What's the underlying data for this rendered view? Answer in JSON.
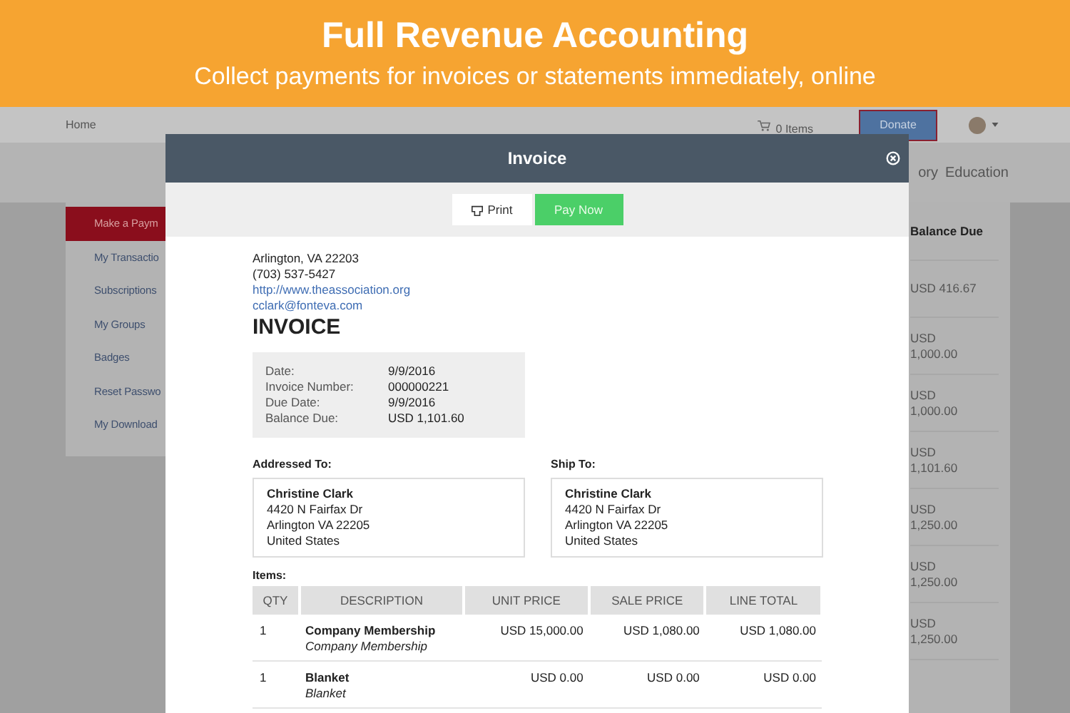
{
  "banner": {
    "title": "Full Revenue Accounting",
    "subtitle": "Collect payments for invoices or statements immediately, online"
  },
  "topbar": {
    "home": "Home",
    "cart": "0 Items",
    "donate": "Donate"
  },
  "nav": [
    "ory",
    "Education"
  ],
  "sidebar": [
    {
      "label": "Make a Paym",
      "selected": true
    },
    {
      "label": "My Transactio",
      "selected": false
    },
    {
      "label": "Subscriptions",
      "selected": false
    },
    {
      "label": "My Groups",
      "selected": false
    },
    {
      "label": "Badges",
      "selected": false
    },
    {
      "label": "Reset Passwo",
      "selected": false
    },
    {
      "label": "My Download",
      "selected": false
    }
  ],
  "balance": {
    "heading": "Balance Due",
    "rows": [
      "USD 416.67",
      "USD 1,000.00",
      "USD 1,000.00",
      "USD 1,101.60",
      "USD 1,250.00",
      "USD 1,250.00",
      "USD 1,250.00"
    ]
  },
  "modal": {
    "title": "Invoice",
    "print": "Print",
    "pay": "Pay Now",
    "address": [
      {
        "kind": "text",
        "text": "Arlington, VA 22203"
      },
      {
        "kind": "text",
        "text": "(703) 537-5427"
      },
      {
        "kind": "link",
        "text": "http://www.theassociation.org"
      },
      {
        "kind": "link",
        "text": "cclark@fonteva.com"
      }
    ],
    "heading": "INVOICE",
    "info": [
      {
        "label": "Date:",
        "value": "9/9/2016"
      },
      {
        "label": "Invoice Number:",
        "value": "000000221"
      },
      {
        "label": "Due Date:",
        "value": "9/9/2016"
      },
      {
        "label": "Balance Due:",
        "value": "USD 1,101.60"
      }
    ],
    "parties": [
      {
        "heading": "Addressed To:",
        "name": "Christine Clark",
        "lines": [
          "4420 N Fairfax Dr",
          "Arlington VA 22205",
          "United States"
        ]
      },
      {
        "heading": "Ship To:",
        "name": "Christine Clark",
        "lines": [
          "4420 N Fairfax Dr",
          "Arlington VA 22205",
          "United States"
        ]
      }
    ],
    "items_label": "Items:",
    "table": {
      "columns": [
        "QTY",
        "DESCRIPTION",
        "UNIT PRICE",
        "SALE PRICE",
        "LINE TOTAL"
      ],
      "rows": [
        {
          "qty": "1",
          "name": "Company Membership",
          "detail": "Company Membership",
          "unit": "USD 15,000.00",
          "sale": "USD 1,080.00",
          "total": "USD 1,080.00"
        },
        {
          "qty": "1",
          "name": "Blanket",
          "detail": "Blanket",
          "unit": "USD 0.00",
          "sale": "USD 0.00",
          "total": "USD 0.00"
        }
      ]
    }
  }
}
